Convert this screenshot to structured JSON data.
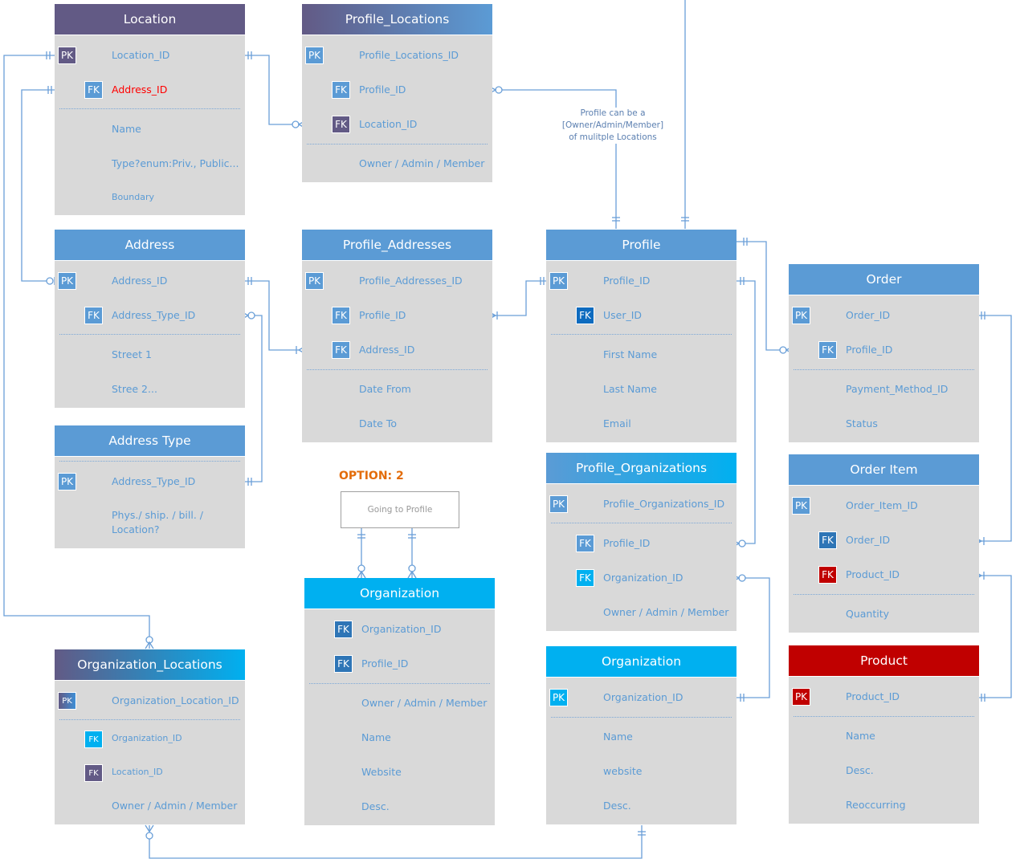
{
  "colors": {
    "purple": "#625a85",
    "blue": "#5b9bd5",
    "cyan": "#00b0f0",
    "dark_blue": "#2e75b6",
    "navy": "#0e6bbf",
    "red": "#c00000",
    "field_text": "#5b9bd5",
    "field_red": "#ff0000",
    "entity_bg": "#d9d9d9",
    "connector": "#6a9fd8",
    "option": "#e36c09"
  },
  "entities": {
    "location": {
      "title": "Location",
      "fields": [
        {
          "key": "PK",
          "name": "Location_ID"
        },
        {
          "key": "FK",
          "name": "Address_ID"
        },
        {
          "key": "",
          "name": "Name"
        },
        {
          "key": "",
          "name": "Type?enum:Priv., Public..."
        },
        {
          "key": "",
          "name": "Boundary"
        }
      ]
    },
    "profile_locations": {
      "title": "Profile_Locations",
      "fields": [
        {
          "key": "PK",
          "name": "Profile_Locations_ID"
        },
        {
          "key": "FK",
          "name": "Profile_ID"
        },
        {
          "key": "FK",
          "name": "Location_ID"
        },
        {
          "key": "",
          "name": "Owner / Admin / Member"
        }
      ]
    },
    "address": {
      "title": "Address",
      "fields": [
        {
          "key": "PK",
          "name": "Address_ID"
        },
        {
          "key": "FK",
          "name": "Address_Type_ID"
        },
        {
          "key": "",
          "name": "Street 1"
        },
        {
          "key": "",
          "name": "Stree 2..."
        }
      ]
    },
    "address_type": {
      "title": "Address Type",
      "fields": [
        {
          "key": "PK",
          "name": "Address_Type_ID"
        },
        {
          "key": "",
          "name": "Phys./ ship. / bill. /"
        },
        {
          "key": "",
          "name": "Location?"
        }
      ]
    },
    "profile_addresses": {
      "title": "Profile_Addresses",
      "fields": [
        {
          "key": "PK",
          "name": "Profile_Addresses_ID"
        },
        {
          "key": "FK",
          "name": "Profile_ID"
        },
        {
          "key": "FK",
          "name": "Address_ID"
        },
        {
          "key": "",
          "name": "Date From"
        },
        {
          "key": "",
          "name": "Date To"
        }
      ]
    },
    "profile": {
      "title": "Profile",
      "fields": [
        {
          "key": "PK",
          "name": "Profile_ID"
        },
        {
          "key": "FK",
          "name": "User_ID"
        },
        {
          "key": "",
          "name": "First Name"
        },
        {
          "key": "",
          "name": "Last Name"
        },
        {
          "key": "",
          "name": "Email"
        }
      ]
    },
    "order": {
      "title": "Order",
      "fields": [
        {
          "key": "PK",
          "name": "Order_ID"
        },
        {
          "key": "FK",
          "name": "Profile_ID"
        },
        {
          "key": "",
          "name": "Payment_Method_ID"
        },
        {
          "key": "",
          "name": "Status"
        }
      ]
    },
    "order_item": {
      "title": "Order Item",
      "fields": [
        {
          "key": "PK",
          "name": "Order_Item_ID"
        },
        {
          "key": "FK",
          "name": "Order_ID"
        },
        {
          "key": "FK",
          "name": "Product_ID"
        },
        {
          "key": "",
          "name": "Quantity"
        }
      ]
    },
    "profile_organizations": {
      "title": "Profile_Organizations",
      "fields": [
        {
          "key": "PK",
          "name": "Profile_Organizations_ID"
        },
        {
          "key": "FK",
          "name": "Profile_ID"
        },
        {
          "key": "FK",
          "name": "Organization_ID"
        },
        {
          "key": "",
          "name": "Owner / Admin / Member"
        }
      ]
    },
    "organization_option2": {
      "title": "Organization",
      "fields": [
        {
          "key": "FK",
          "name": "Organization_ID"
        },
        {
          "key": "FK",
          "name": "Profile_ID"
        },
        {
          "key": "",
          "name": "Owner / Admin / Member"
        },
        {
          "key": "",
          "name": "Name"
        },
        {
          "key": "",
          "name": "Website"
        },
        {
          "key": "",
          "name": "Desc."
        }
      ]
    },
    "organization": {
      "title": "Organization",
      "fields": [
        {
          "key": "PK",
          "name": "Organization_ID"
        },
        {
          "key": "",
          "name": "Name"
        },
        {
          "key": "",
          "name": "website"
        },
        {
          "key": "",
          "name": "Desc."
        }
      ]
    },
    "product": {
      "title": "Product",
      "fields": [
        {
          "key": "PK",
          "name": "Product_ID"
        },
        {
          "key": "",
          "name": "Name"
        },
        {
          "key": "",
          "name": "Desc."
        },
        {
          "key": "",
          "name": "Reoccurring"
        }
      ]
    },
    "organization_locations": {
      "title": "Organization_Locations",
      "fields": [
        {
          "key": "PK",
          "name": "Organization_Location_ID"
        },
        {
          "key": "FK",
          "name": "Organization_ID"
        },
        {
          "key": "FK",
          "name": "Location_ID"
        },
        {
          "key": "",
          "name": "Owner / Admin / Member"
        }
      ]
    }
  },
  "annotations": {
    "profile_locations_note_line1": "Profile can be a",
    "profile_locations_note_line2": "[Owner/Admin/Member]",
    "profile_locations_note_line3": "of mulitple Locations",
    "option_label": "OPTION: 2",
    "going_to_profile": "Going to Profile"
  }
}
